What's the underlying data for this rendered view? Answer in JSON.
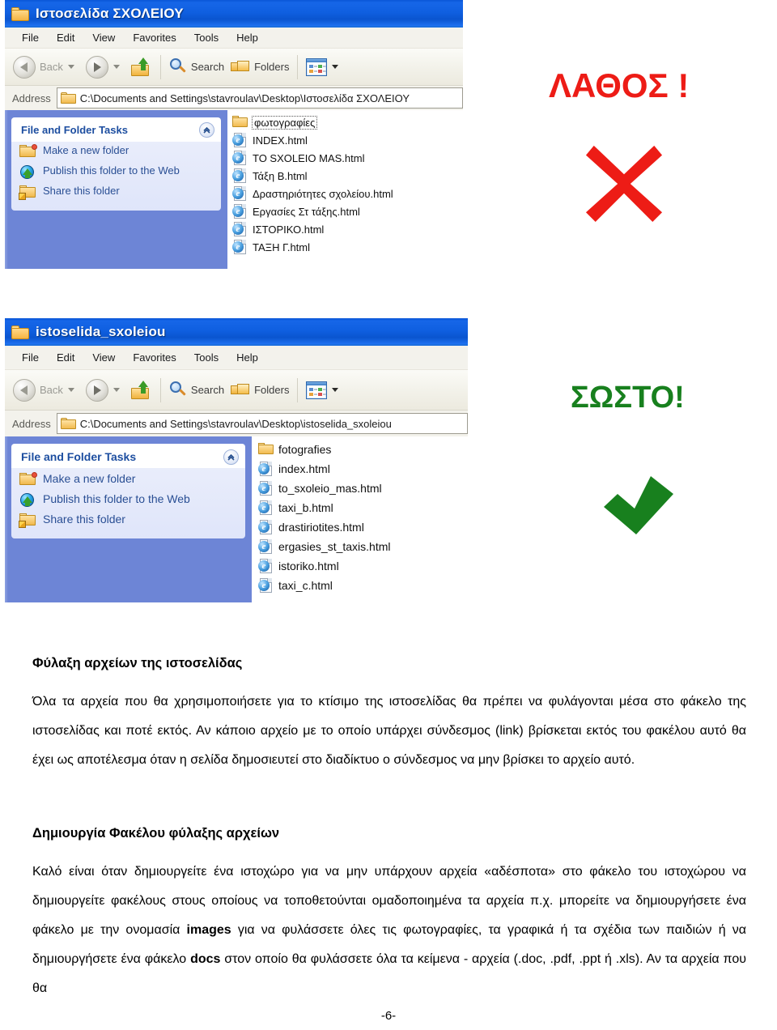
{
  "windows": [
    {
      "id": "wrong",
      "title": "Ιστοσελίδα ΣΧΟΛΕΙΟΥ",
      "menu": [
        "File",
        "Edit",
        "View",
        "Favorites",
        "Tools",
        "Help"
      ],
      "toolbar": {
        "back": "Back",
        "search": "Search",
        "folders": "Folders"
      },
      "address": {
        "label": "Address",
        "value": "C:\\Documents and Settings\\stavroulav\\Desktop\\Ιστοσελίδα ΣΧΟΛΕΙΟΥ"
      },
      "tasks": {
        "title": "File and Folder Tasks",
        "items": [
          "Make a new folder",
          "Publish this folder to the Web",
          "Share this folder"
        ]
      },
      "files": [
        {
          "name": "φωτογραφίες",
          "type": "folder",
          "selected": true
        },
        {
          "name": "INDEX.html",
          "type": "html",
          "selected": false
        },
        {
          "name": "TO SXOLEIO MAS.html",
          "type": "html",
          "selected": false
        },
        {
          "name": "Τάξη Β.html",
          "type": "html",
          "selected": false
        },
        {
          "name": "Δραστηριότητες σχολείου.html",
          "type": "html",
          "selected": false
        },
        {
          "name": "Εργασίες Στ τάξης.html",
          "type": "html",
          "selected": false
        },
        {
          "name": "ΙΣΤΟΡΙΚΟ.html",
          "type": "html",
          "selected": false
        },
        {
          "name": "ΤΑΞΗ Γ.html",
          "type": "html",
          "selected": false
        }
      ]
    },
    {
      "id": "right",
      "title": "istoselida_sxoleiou",
      "menu": [
        "File",
        "Edit",
        "View",
        "Favorites",
        "Tools",
        "Help"
      ],
      "toolbar": {
        "back": "Back",
        "search": "Search",
        "folders": "Folders"
      },
      "address": {
        "label": "Address",
        "value": "C:\\Documents and Settings\\stavroulav\\Desktop\\istoselida_sxoleiou"
      },
      "tasks": {
        "title": "File and Folder Tasks",
        "items": [
          "Make a new folder",
          "Publish this folder to the Web",
          "Share this folder"
        ]
      },
      "files": [
        {
          "name": "fotografies",
          "type": "folder",
          "selected": false
        },
        {
          "name": "index.html",
          "type": "html",
          "selected": false
        },
        {
          "name": "to_sxoleio_mas.html",
          "type": "html",
          "selected": false
        },
        {
          "name": "taxi_b.html",
          "type": "html",
          "selected": false
        },
        {
          "name": "drastiriotites.html",
          "type": "html",
          "selected": false
        },
        {
          "name": "ergasies_st_taxis.html",
          "type": "html",
          "selected": false
        },
        {
          "name": "istoriko.html",
          "type": "html",
          "selected": false
        },
        {
          "name": "taxi_c.html",
          "type": "html",
          "selected": false
        }
      ]
    }
  ],
  "marks": {
    "wrong": {
      "label": "ΛΑΘΟΣ !",
      "color": "#ED1C16",
      "icon": "x-mark-icon"
    },
    "right": {
      "label": "ΣΩΣΤΟ!",
      "color": "#18801E",
      "icon": "check-mark-icon"
    }
  },
  "document": {
    "heading1": "Φύλαξη αρχείων της ιστοσελίδας",
    "paragraph1": "Όλα τα αρχεία που θα χρησιμοποιήσετε για το κτίσιμο της ιστοσελίδας θα πρέπει να φυλάγονται μέσα στο φάκελο της ιστοσελίδας και ποτέ εκτός. Αν κάποιο αρχείο με το οποίο υπάρχει σύνδεσμος (link) βρίσκεται εκτός του φακέλου αυτό θα έχει ως αποτέλεσμα όταν η σελίδα δημοσιευτεί στο διαδίκτυο  ο σύνδεσμος να μην βρίσκει το αρχείο αυτό.",
    "heading2": "Δημιουργία Φακέλου φύλαξης αρχείων",
    "paragraph2_part1": "Καλό είναι όταν δημιουργείτε ένα ιστοχώρο για να μην υπάρχουν αρχεία «αδέσποτα» στο φάκελο του ιστοχώρου να δημιουργείτε φακέλους στους οποίους να τοποθετούνται ομαδοποιημένα τα αρχεία π.χ. μπορείτε να δημιουργήσετε ένα φάκελο με την ονομασία ",
    "paragraph2_bold1": "images",
    "paragraph2_part2": " για να φυλάσσετε όλες τις φωτογραφίες, τα γραφικά ή τα σχέδια των παιδιών ή να δημιουργήσετε ένα φάκελο ",
    "paragraph2_bold2": "docs",
    "paragraph2_part3": " στον οποίο θα φυλάσσετε όλα τα κείμενα - αρχεία (.doc, .pdf, .ppt ή .xls). Αν τα αρχεία που θα",
    "page_number": "-6-"
  }
}
